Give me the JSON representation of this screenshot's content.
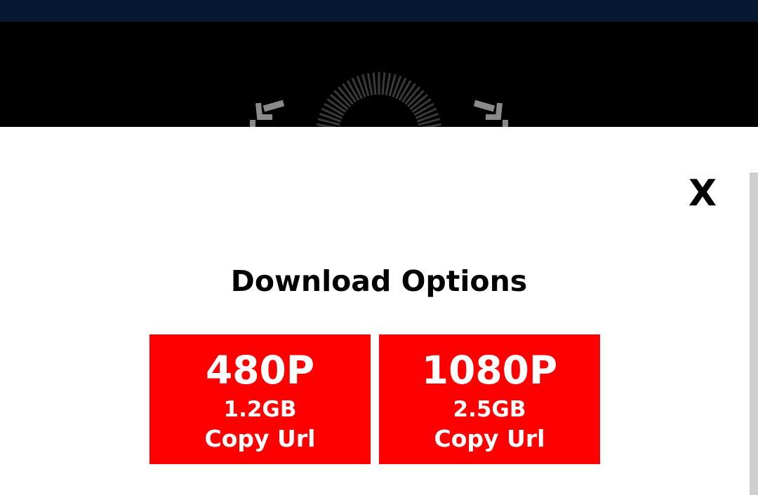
{
  "player": {
    "controls": {
      "rewind_icon": "rewind-10-icon",
      "forward_icon": "forward-10-icon",
      "loading_icon": "loading-spinner-icon"
    }
  },
  "modal": {
    "close_label": "X",
    "title": "Download Options",
    "options": [
      {
        "resolution": "480P",
        "size": "1.2GB",
        "action": "Copy Url"
      },
      {
        "resolution": "1080P",
        "size": "2.5GB",
        "action": "Copy Url"
      }
    ]
  },
  "colors": {
    "topbar": "#071833",
    "player_bg": "#000000",
    "button_bg": "#ff0000",
    "button_text": "#ffffff",
    "scrollbar": "#cfcfcf"
  }
}
